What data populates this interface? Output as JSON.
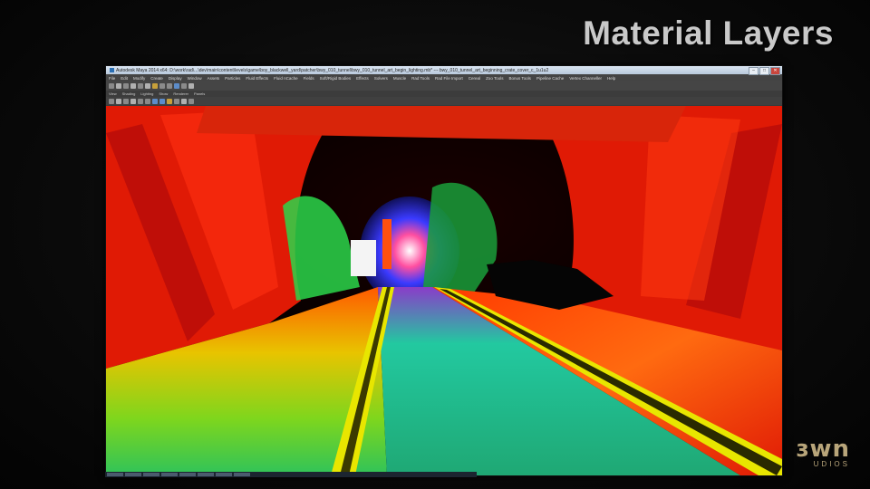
{
  "slide": {
    "title": "Material Layers",
    "logo_main": "ɜwn",
    "logo_sub": "UDIOS"
  },
  "window": {
    "title": "Autodesk Maya 2014 x64: D:\\work\\rad\\...\\dev\\main\\content\\levels\\game\\boy_blackwell_yard\\patcher\\bwy_010_tunnel\\bwy_010_tunnel_art_begin_lighting.mb*   ---   bwy_010_tunnel_art_beginning_crate_cover_c_1u1u2",
    "buttons": [
      "–",
      "□",
      "✕"
    ]
  },
  "menubar": [
    "File",
    "Edit",
    "Modify",
    "Create",
    "Display",
    "Window",
    "Assets",
    "Particles",
    "Fluid Effects",
    "Fluid nCache",
    "Fields",
    "Soft/Rigid Bodies",
    "Effects",
    "Solvers",
    "Muscle",
    "Rad Tools",
    "Rad File Import",
    "Cereal",
    "Zoo Tools",
    "Bonus Tools",
    "Pipeline Cache",
    "Vertex Channeller",
    "Help"
  ],
  "panel_menu": [
    "View",
    "Shading",
    "Lighting",
    "Show",
    "Renderer",
    "Panels"
  ],
  "colors": {
    "title_text": "#c9c9c9",
    "logo": "#b8a57a",
    "tunnel_wall": "#e01a05",
    "track_green": "#22d16a",
    "rail_yellow": "#e8e600"
  }
}
